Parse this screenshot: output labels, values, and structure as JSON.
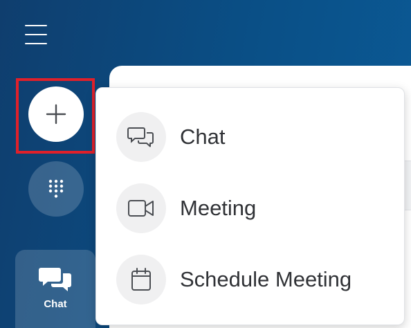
{
  "sidebar": {
    "menu_icon": "hamburger-menu-icon",
    "new_button_icon": "plus-icon",
    "dialpad_icon": "dialpad-icon",
    "nav_items": [
      {
        "label": "Chat",
        "icon": "chat-bubbles-icon"
      }
    ]
  },
  "popup_menu": {
    "items": [
      {
        "label": "Chat",
        "icon": "chat-bubbles-outline-icon"
      },
      {
        "label": "Meeting",
        "icon": "video-camera-icon"
      },
      {
        "label": "Schedule Meeting",
        "icon": "calendar-icon"
      }
    ]
  },
  "colors": {
    "sidebar_blue": "#0a4f86",
    "highlight_red": "#e0202a",
    "menu_text": "#303236",
    "icon_circle": "#f0f0f1"
  }
}
